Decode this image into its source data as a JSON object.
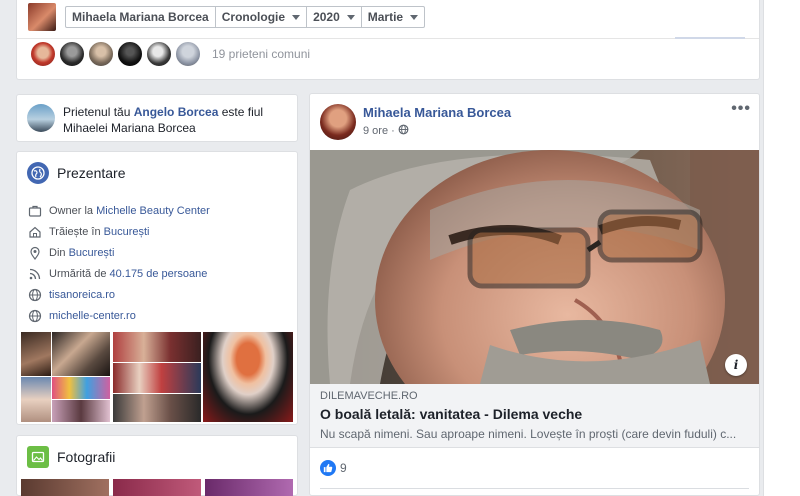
{
  "breadcrumb": {
    "name": "Mihaela Mariana Borcea",
    "section": "Cronologie",
    "year": "2020",
    "month": "Martie"
  },
  "friends": {
    "mutual_text": "19 prieteni comuni"
  },
  "friend_note": {
    "prefix": "Prietenul tău ",
    "friend_name": "Angelo Borcea",
    "suffix": " este fiul Mihaelei Mariana Borcea"
  },
  "intro": {
    "title": "Prezentare",
    "items": [
      {
        "icon": "briefcase-icon",
        "label": "Owner la ",
        "link": "Michelle Beauty Center"
      },
      {
        "icon": "home-icon",
        "label": "Trăiește în ",
        "link": "București"
      },
      {
        "icon": "location-pin-icon",
        "label": "Din ",
        "link": "București"
      },
      {
        "icon": "feed-icon",
        "label": "Urmărită de ",
        "link": "40.175 de persoane"
      },
      {
        "icon": "globe-icon",
        "label": "",
        "link": "tisanoreica.ro"
      },
      {
        "icon": "globe-icon",
        "label": "",
        "link": "michelle-center.ro"
      }
    ]
  },
  "photos": {
    "title": "Fotografii"
  },
  "post": {
    "author": "Mihaela Mariana Borcea",
    "time": "9 ore",
    "more": "•••",
    "link": {
      "domain": "DILEMAVECHE.RO",
      "title": "O boală letală: vanitatea - Dilema veche",
      "description": "Nu scapă nimeni. Sau aproape nimeni. Lovește în proști (care devin fuduli) c..."
    },
    "likes": "9",
    "info": "i"
  }
}
